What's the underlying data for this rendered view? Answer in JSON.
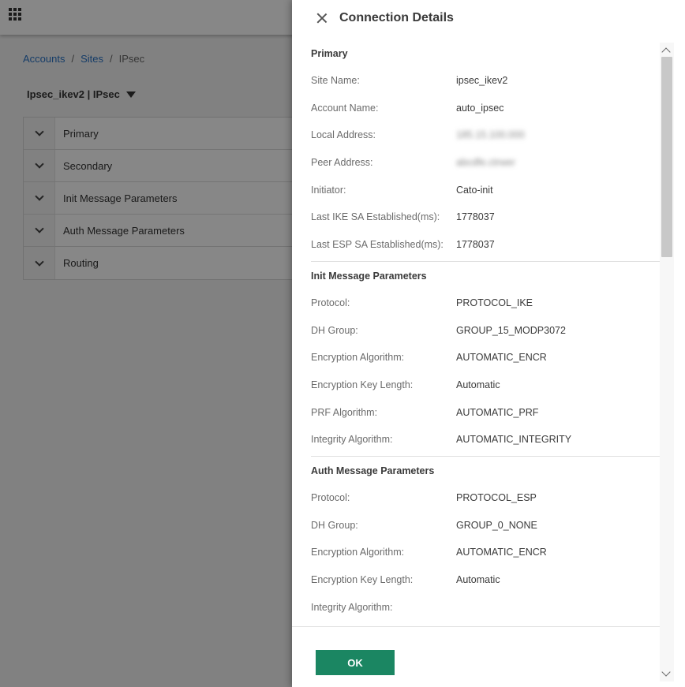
{
  "app": {
    "breadcrumb": [
      "Accounts",
      "Sites",
      "IPsec"
    ],
    "breadcrumb_sep": "/",
    "site_selector": "Ipsec_ikev2 | IPsec",
    "accordion": [
      "Primary",
      "Secondary",
      "Init Message Parameters",
      "Auth Message Parameters",
      "Routing"
    ]
  },
  "drawer": {
    "title": "Connection Details",
    "ok_label": "OK",
    "sections": [
      {
        "title": "Primary",
        "fields": [
          {
            "label": "Site Name:",
            "value": "ipsec_ikev2"
          },
          {
            "label": "Account Name:",
            "value": "auto_ipsec"
          },
          {
            "label": "Local Address:",
            "value": "185.15.100.000",
            "blurred": true
          },
          {
            "label": "Peer Address:",
            "value": "abcdfe.ctrwer",
            "blurred": true
          },
          {
            "label": "Initiator:",
            "value": "Cato-init"
          },
          {
            "label": "Last IKE SA Established(ms):",
            "value": "1778037"
          },
          {
            "label": "Last ESP SA Established(ms):",
            "value": "1778037"
          }
        ]
      },
      {
        "title": "Init Message Parameters",
        "fields": [
          {
            "label": "Protocol:",
            "value": "PROTOCOL_IKE"
          },
          {
            "label": "DH Group:",
            "value": "GROUP_15_MODP3072"
          },
          {
            "label": "Encryption Algorithm:",
            "value": "AUTOMATIC_ENCR"
          },
          {
            "label": "Encryption Key Length:",
            "value": "Automatic"
          },
          {
            "label": "PRF Algorithm:",
            "value": "AUTOMATIC_PRF"
          },
          {
            "label": "Integrity Algorithm:",
            "value": "AUTOMATIC_INTEGRITY"
          }
        ]
      },
      {
        "title": "Auth Message Parameters",
        "fields": [
          {
            "label": "Protocol:",
            "value": "PROTOCOL_ESP"
          },
          {
            "label": "DH Group:",
            "value": "GROUP_0_NONE"
          },
          {
            "label": "Encryption Algorithm:",
            "value": "AUTOMATIC_ENCR"
          },
          {
            "label": "Encryption Key Length:",
            "value": "Automatic"
          },
          {
            "label": "Integrity Algorithm:",
            "value": ""
          }
        ]
      }
    ]
  }
}
